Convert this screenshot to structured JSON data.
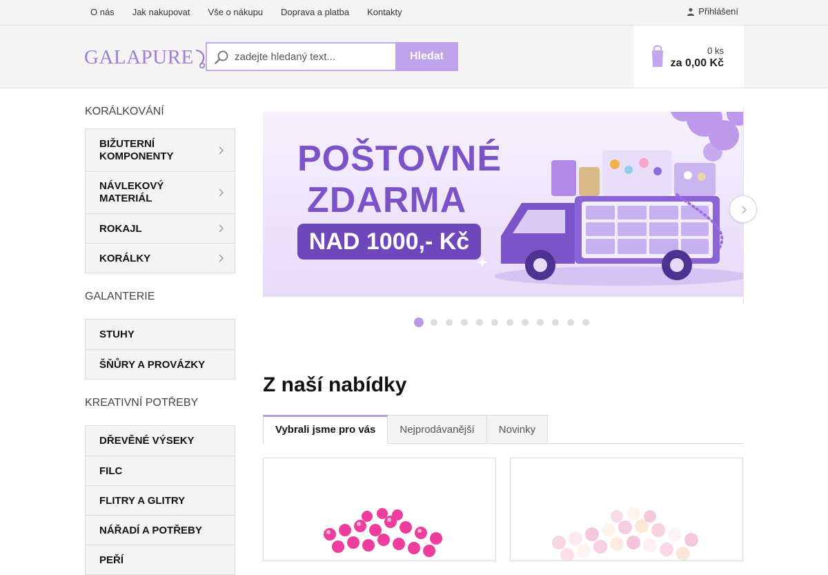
{
  "topnav": {
    "items": [
      "O nás",
      "Jak nakupovat",
      "Vše o nákupu",
      "Doprava a platba",
      "Kontakty"
    ],
    "login": "Přihlášení",
    "login_icon": "user-icon"
  },
  "header": {
    "logo": "GALAPURE",
    "search": {
      "placeholder": "zadejte hledaný text...",
      "value": "",
      "button": "Hledat",
      "icon": "search-icon"
    },
    "cart": {
      "count": "0 ks",
      "total": "za 0,00 Kč",
      "icon": "shopping-bag-icon"
    }
  },
  "sidebar": {
    "groups": [
      {
        "title": "Korálkování",
        "items": [
          {
            "label": "Bižuterní komponenty",
            "has_arrow": true
          },
          {
            "label": "Návlekový materiál",
            "has_arrow": true
          },
          {
            "label": "Rokajl",
            "has_arrow": true
          },
          {
            "label": "Korálky",
            "has_arrow": true
          }
        ]
      },
      {
        "title": "Galanterie",
        "items": [
          {
            "label": "Stuhy"
          },
          {
            "label": "Šňůry a provázky"
          }
        ]
      },
      {
        "title": "Kreativní potřeby",
        "items": [
          {
            "label": "Dřevěné výseky"
          },
          {
            "label": "Filc"
          },
          {
            "label": "Flitry a glitry"
          },
          {
            "label": "Nářadí a potřeby"
          },
          {
            "label": "Peří"
          }
        ]
      }
    ]
  },
  "banner": {
    "line1": "POŠTOVNÉ",
    "line2": "ZDARMA",
    "pill": "NAD 1000,- Kč",
    "slide_count": 12,
    "active_slide": 1,
    "colors": {
      "accent": "#7b52c7",
      "pill": "#6e48bb"
    }
  },
  "offer": {
    "title": "Z naší nabídky",
    "tabs": [
      "Vybrali jsme pro vás",
      "Nejprodávanější",
      "Novinky"
    ],
    "active_tab": 0
  },
  "colors": {
    "brand": "#a07fd0",
    "button": "#bea3ea",
    "dot_active": "#b699e6"
  }
}
